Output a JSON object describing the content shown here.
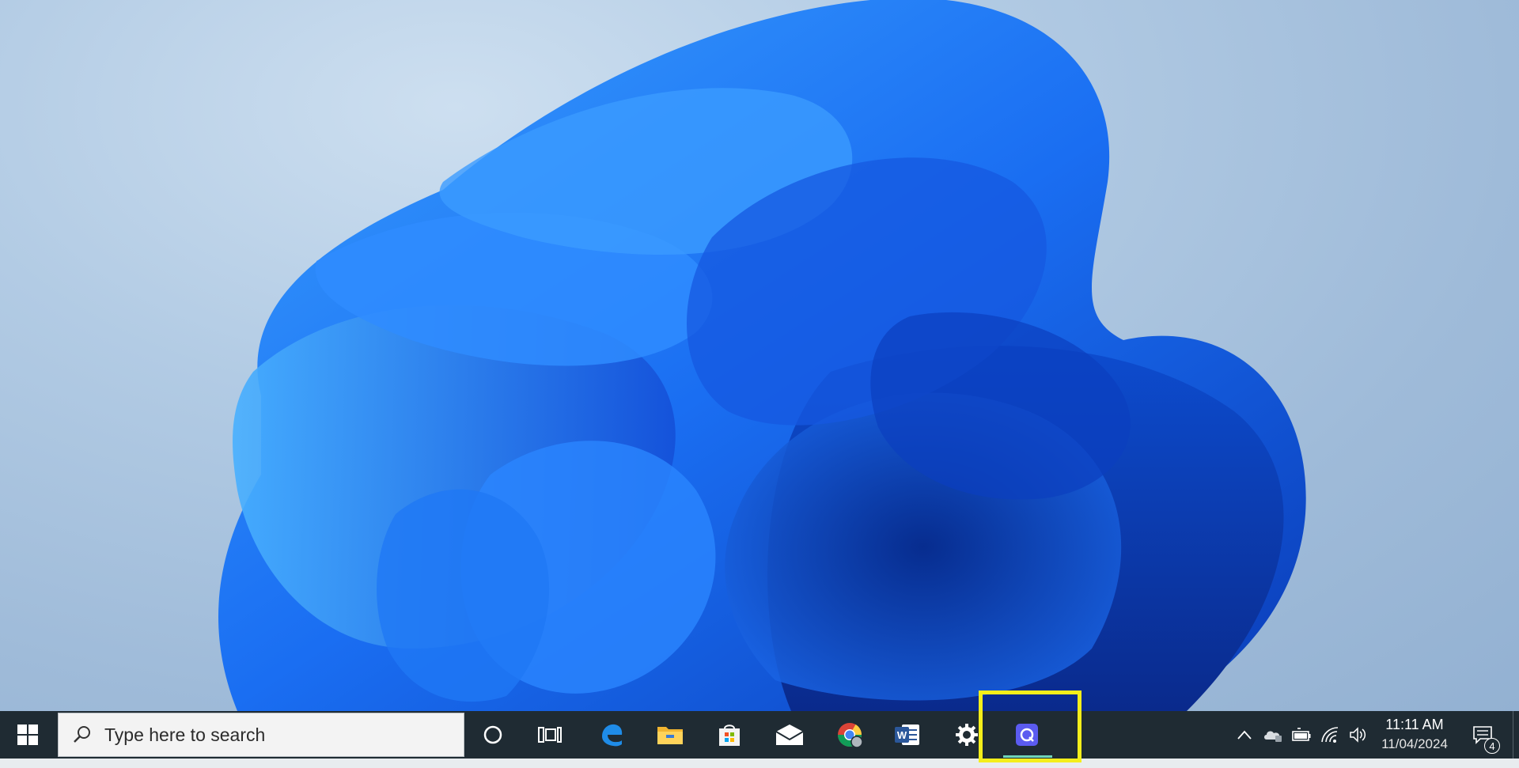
{
  "taskbar": {
    "search_placeholder": "Type here to search",
    "pinned_apps": [
      {
        "name": "cortana",
        "icon": "cortana-circle-icon"
      },
      {
        "name": "task-view",
        "icon": "task-view-icon"
      },
      {
        "name": "edge",
        "icon": "edge-icon"
      },
      {
        "name": "file-explorer",
        "icon": "folder-icon"
      },
      {
        "name": "microsoft-store",
        "icon": "store-bag-icon"
      },
      {
        "name": "mail",
        "icon": "mail-icon"
      },
      {
        "name": "chrome",
        "icon": "chrome-icon"
      },
      {
        "name": "word",
        "icon": "word-icon",
        "label": "W"
      },
      {
        "name": "settings",
        "icon": "gear-icon"
      },
      {
        "name": "highlighted-app",
        "icon": "q-app-icon",
        "label": "Q",
        "active": true
      }
    ],
    "tray": {
      "clock_time": "11:11 AM",
      "clock_date": "11/04/2024",
      "notification_count": "4"
    }
  },
  "colors": {
    "taskbar_bg": "#1f2b33",
    "highlight": "#f4ee1a",
    "active_underline": "#6fd4b8",
    "q_app_bg": "#5b5bf0"
  }
}
